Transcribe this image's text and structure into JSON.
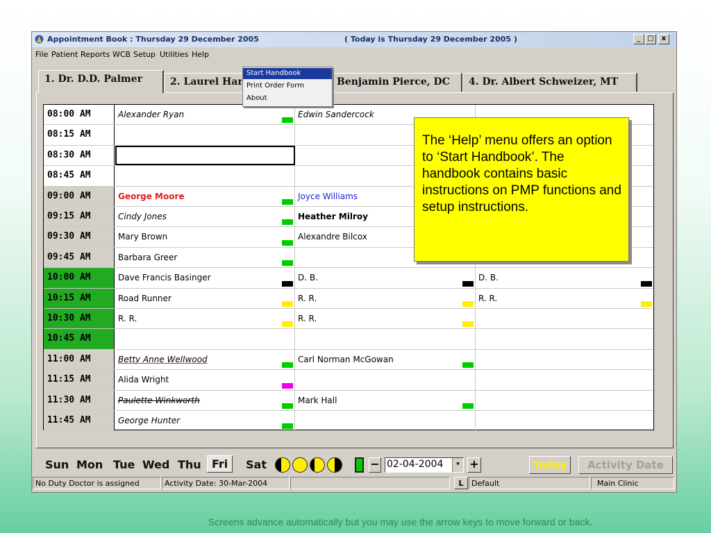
{
  "window": {
    "title": "Appointment Book : Thursday 29 December 2005",
    "today": "( Today is Thursday 29 December 2005 )",
    "controls": {
      "minimize": "_",
      "maximize": "□",
      "close": "x"
    }
  },
  "menubar": [
    "File",
    "Patient",
    "Reports",
    "WCB",
    "Setup",
    "Utilities",
    "Help"
  ],
  "help_menu": {
    "items": [
      "Start Handbook",
      "Print Order Form",
      "About"
    ],
    "highlighted": "Start Handbook"
  },
  "tabs": [
    "1. Dr. D.D. Palmer",
    "2. Laurel Hard",
    "Benjamin Pierce, DC",
    "4. Dr. Albert Schweizer, MT"
  ],
  "schedule": {
    "rows": [
      {
        "time": "08:00 AM",
        "time_style": "white",
        "c1": "Alexander Ryan",
        "c1_style": "it",
        "c1_marker": "#00cc00",
        "c2": "Edwin Sandercock",
        "c2_style": "it",
        "c2_marker": "",
        "c3": "",
        "c3_marker": ""
      },
      {
        "time": "08:15 AM",
        "time_style": "white",
        "c1": "",
        "c1_style": "",
        "c1_marker": "",
        "c2": "",
        "c2_style": "",
        "c2_marker": "",
        "c3": "",
        "c3_marker": ""
      },
      {
        "time": "08:30 AM",
        "time_style": "white",
        "c1": "",
        "c1_style": "selected",
        "c1_marker": "",
        "c2": "",
        "c2_style": "",
        "c2_marker": "",
        "c3": "",
        "c3_marker": ""
      },
      {
        "time": "08:45 AM",
        "time_style": "white",
        "c1": "",
        "c1_style": "",
        "c1_marker": "",
        "c2": "",
        "c2_style": "",
        "c2_marker": "",
        "c3": "",
        "c3_marker": ""
      },
      {
        "time": "09:00 AM",
        "time_style": "gray",
        "c1": "George Moore",
        "c1_style": "red",
        "c1_marker": "#00cc00",
        "c2": "Joyce Williams",
        "c2_style": "blue",
        "c2_marker": "",
        "c3": "",
        "c3_marker": ""
      },
      {
        "time": "09:15 AM",
        "time_style": "gray",
        "c1": "Cindy Jones",
        "c1_style": "it",
        "c1_marker": "#00cc00",
        "c2": "Heather Milroy",
        "c2_style": "bold",
        "c2_marker": "",
        "c3": "",
        "c3_marker": ""
      },
      {
        "time": "09:30 AM",
        "time_style": "gray",
        "c1": "Mary Brown",
        "c1_style": "",
        "c1_marker": "#00cc00",
        "c2": "Alexandre Bilcox",
        "c2_style": "",
        "c2_marker": "",
        "c3": "",
        "c3_marker": ""
      },
      {
        "time": "09:45 AM",
        "time_style": "gray",
        "c1": "Barbara Greer",
        "c1_style": "",
        "c1_marker": "#00cc00",
        "c2": "",
        "c2_style": "",
        "c2_marker": "",
        "c3": "",
        "c3_marker": ""
      },
      {
        "time": "10:00 AM",
        "time_style": "green",
        "c1": "Dave Francis Basinger",
        "c1_style": "",
        "c1_marker": "#000000",
        "c2": "D. B.",
        "c2_style": "",
        "c2_marker": "#000000",
        "c3": "D. B.",
        "c3_marker": "#000000"
      },
      {
        "time": "10:15 AM",
        "time_style": "green",
        "c1": "Road Runner",
        "c1_style": "",
        "c1_marker": "#ffee00",
        "c2": "R. R.",
        "c2_style": "",
        "c2_marker": "#ffee00",
        "c3": "R. R.",
        "c3_marker": "#ffee00"
      },
      {
        "time": "10:30 AM",
        "time_style": "green",
        "c1": "R. R.",
        "c1_style": "",
        "c1_marker": "#ffee00",
        "c2": "R. R.",
        "c2_style": "",
        "c2_marker": "#ffee00",
        "c3": "",
        "c3_marker": ""
      },
      {
        "time": "10:45 AM",
        "time_style": "green",
        "c1": "",
        "c1_style": "",
        "c1_marker": "",
        "c2": "",
        "c2_style": "",
        "c2_marker": "",
        "c3": "",
        "c3_marker": ""
      },
      {
        "time": "11:00 AM",
        "time_style": "gray",
        "c1": "Betty Anne Wellwood",
        "c1_style": "ul-red",
        "c1_marker": "#00cc00",
        "c2": "Carl Norman McGowan",
        "c2_style": "",
        "c2_marker": "#00cc00",
        "c3": "",
        "c3_marker": ""
      },
      {
        "time": "11:15 AM",
        "time_style": "gray",
        "c1": "Alida Wright",
        "c1_style": "",
        "c1_marker": "#ee00ee",
        "c2": "",
        "c2_style": "",
        "c2_marker": "",
        "c3": "",
        "c3_marker": ""
      },
      {
        "time": "11:30 AM",
        "time_style": "gray",
        "c1": "Paulette Winkworth",
        "c1_style": "strike",
        "c1_marker": "#00cc00",
        "c2": "Mark Hall",
        "c2_style": "",
        "c2_marker": "#00cc00",
        "c3": "",
        "c3_marker": ""
      },
      {
        "time": "11:45 AM",
        "time_style": "gray",
        "c1": "George Hunter",
        "c1_style": "it",
        "c1_marker": "#00cc00",
        "c2": "",
        "c2_style": "",
        "c2_marker": "",
        "c3": "",
        "c3_marker": ""
      }
    ]
  },
  "callout": "The ‘Help’ menu offers an option to ‘Start Handbook’. The handbook contains basic instructions on PMP functions and setup instructions.",
  "days": [
    "Sun",
    "Mon",
    "Tue",
    "Wed",
    "Thu",
    "Fri",
    "Sat"
  ],
  "selected_day": "Fri",
  "date_nav": {
    "minus": "−",
    "plus": "+",
    "date": "02-04-2004",
    "dropdown": "▾"
  },
  "buttons": {
    "today": "Today",
    "activity_date": "Activity Date"
  },
  "status": {
    "duty": "No Duty Doctor is assigned",
    "activity": "Activity Date: 30-Mar-2004",
    "empty": "",
    "l_btn": "L",
    "default": "Default",
    "clinic": "Main Clinic"
  },
  "footer": "Screens advance automatically but you may use the arrow keys to move forward or back.",
  "colors": {
    "accent_green": "#22aa22",
    "callout_yellow": "#ffff00",
    "menu_highlight": "#1a3aa0"
  }
}
